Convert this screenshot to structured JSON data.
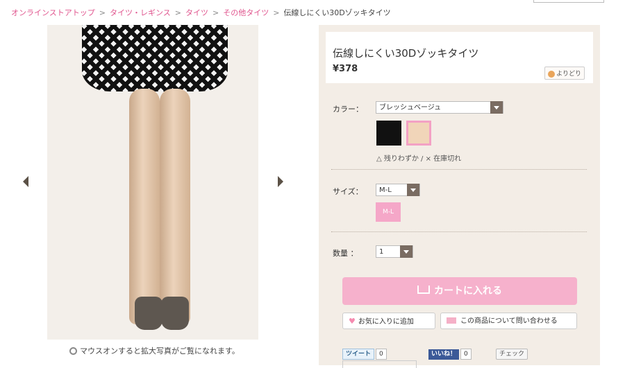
{
  "breadcrumb": {
    "items": [
      "オンラインストアトップ",
      "タイツ・レギンス",
      "タイツ",
      "その他タイツ"
    ],
    "separator": ">",
    "current": "伝線しにくい30Dゾッキタイツ"
  },
  "product": {
    "title": "伝線しにくい30Dゾッキタイツ",
    "price": "¥378",
    "badge": "よりどり"
  },
  "gallery": {
    "zoom_note": "マウスオンすると拡大写真がご覧になれます。"
  },
  "options": {
    "color_label": "カラー：",
    "color_selected": "ブレッシュベージュ",
    "swatch_colors": [
      "#111111",
      "#f1d5b9"
    ],
    "stock_note": "△ 残りわずか / × 在庫切れ",
    "size_label": "サイズ：",
    "size_selected": "M-L",
    "size_chip": "M-L",
    "qty_label": "数量 ：",
    "qty_selected": "1"
  },
  "actions": {
    "cart_label": "カートに入れる",
    "favorite_label": "お気に入りに追加",
    "inquiry_label": "この商品について問い合わせる"
  },
  "social": {
    "tweet_label": "ツイート",
    "tweet_count": "0",
    "like_label": "いいね！",
    "like_count": "0",
    "check_label": "チェック"
  },
  "colors": {
    "accent_pink": "#f6b1cc",
    "link_pink": "#e0558e",
    "panel_bg": "#f3ede6"
  }
}
